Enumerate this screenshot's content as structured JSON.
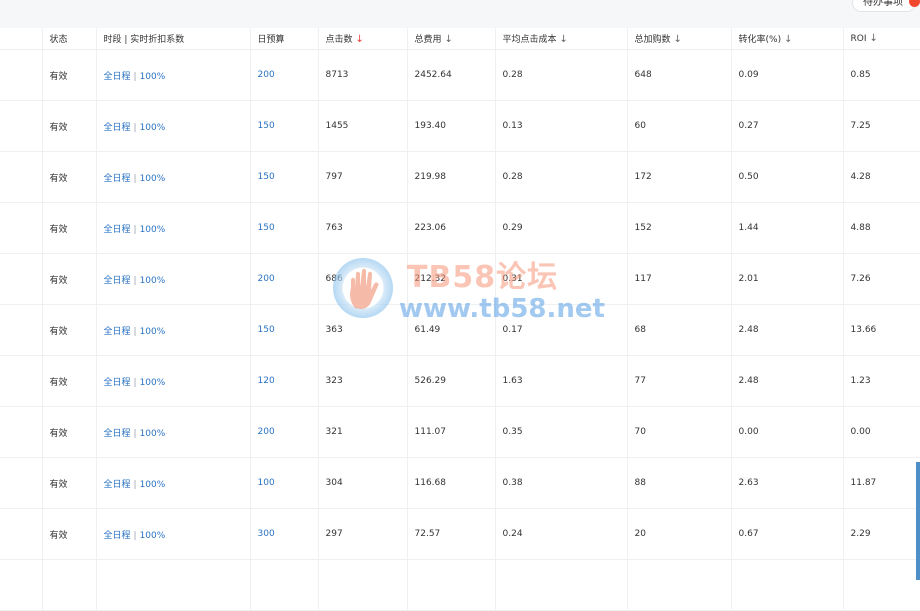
{
  "todo": {
    "label": "待办事项",
    "badge": ""
  },
  "table": {
    "headers": [
      {
        "label": "",
        "arrow": ""
      },
      {
        "label": "状态",
        "arrow": ""
      },
      {
        "label": "时段 | 实时折扣系数",
        "arrow": ""
      },
      {
        "label": "日预算",
        "arrow": ""
      },
      {
        "label": "点击数",
        "arrow": "↓"
      },
      {
        "label": "总费用",
        "arrow": "↓"
      },
      {
        "label": "平均点击成本",
        "arrow": "↓"
      },
      {
        "label": "总加购数",
        "arrow": "↓"
      },
      {
        "label": "转化率(%)",
        "arrow": "↓"
      },
      {
        "label": "ROI",
        "arrow": "↓"
      }
    ],
    "sort_active_column": "点击数",
    "rows": [
      {
        "status": "有效",
        "schedule": "全日程",
        "discount": "100%",
        "budget": "200",
        "clicks": "8713",
        "cost": "2452.64",
        "cpc": "0.28",
        "carts": "648",
        "cvr": "0.09",
        "roi": "0.85"
      },
      {
        "status": "有效",
        "schedule": "全日程",
        "discount": "100%",
        "budget": "150",
        "clicks": "1455",
        "cost": "193.40",
        "cpc": "0.13",
        "carts": "60",
        "cvr": "0.27",
        "roi": "7.25"
      },
      {
        "status": "有效",
        "schedule": "全日程",
        "discount": "100%",
        "budget": "150",
        "clicks": "797",
        "cost": "219.98",
        "cpc": "0.28",
        "carts": "172",
        "cvr": "0.50",
        "roi": "4.28"
      },
      {
        "status": "有效",
        "schedule": "全日程",
        "discount": "100%",
        "budget": "150",
        "clicks": "763",
        "cost": "223.06",
        "cpc": "0.29",
        "carts": "152",
        "cvr": "1.44",
        "roi": "4.88"
      },
      {
        "status": "有效",
        "schedule": "全日程",
        "discount": "100%",
        "budget": "200",
        "clicks": "686",
        "cost": "212.32",
        "cpc": "0.31",
        "carts": "117",
        "cvr": "2.01",
        "roi": "7.26"
      },
      {
        "status": "有效",
        "schedule": "全日程",
        "discount": "100%",
        "budget": "150",
        "clicks": "363",
        "cost": "61.49",
        "cpc": "0.17",
        "carts": "68",
        "cvr": "2.48",
        "roi": "13.66"
      },
      {
        "status": "有效",
        "schedule": "全日程",
        "discount": "100%",
        "budget": "120",
        "clicks": "323",
        "cost": "526.29",
        "cpc": "1.63",
        "carts": "77",
        "cvr": "2.48",
        "roi": "1.23"
      },
      {
        "status": "有效",
        "schedule": "全日程",
        "discount": "100%",
        "budget": "200",
        "clicks": "321",
        "cost": "111.07",
        "cpc": "0.35",
        "carts": "70",
        "cvr": "0.00",
        "roi": "0.00"
      },
      {
        "status": "有效",
        "schedule": "全日程",
        "discount": "100%",
        "budget": "100",
        "clicks": "304",
        "cost": "116.68",
        "cpc": "0.38",
        "carts": "88",
        "cvr": "2.63",
        "roi": "11.87"
      },
      {
        "status": "有效",
        "schedule": "全日程",
        "discount": "100%",
        "budget": "300",
        "clicks": "297",
        "cost": "72.57",
        "cpc": "0.24",
        "carts": "20",
        "cvr": "0.67",
        "roi": "2.29"
      },
      {
        "status": "",
        "schedule": "",
        "discount": "",
        "budget": "",
        "clicks": "",
        "cost": "",
        "cpc": "",
        "carts": "",
        "cvr": "",
        "roi": ""
      }
    ]
  },
  "watermark": {
    "title": "TB58论坛",
    "url": "www.tb58.net"
  },
  "colors": {
    "link": "#2a73c4",
    "sort_active": "#e8413c",
    "badge": "#f0472d",
    "scroll": "#4f8fc8"
  }
}
